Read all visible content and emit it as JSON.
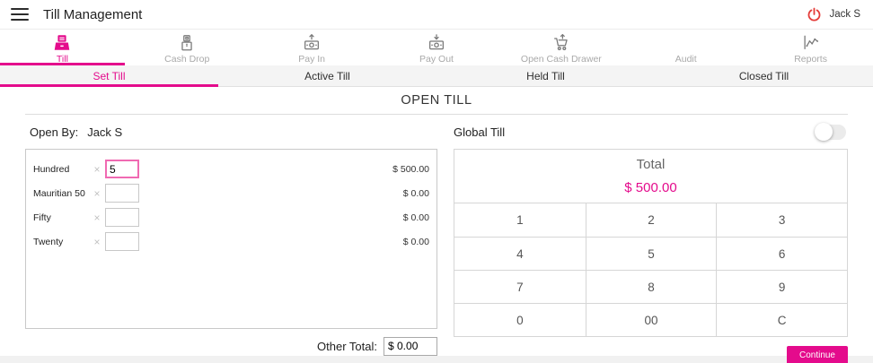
{
  "header": {
    "title": "Till Management",
    "user": "Jack S"
  },
  "nav": {
    "items": [
      {
        "label": "Till",
        "icon": "till-icon",
        "active": true
      },
      {
        "label": "Cash Drop",
        "icon": "cash-drop-icon",
        "active": false
      },
      {
        "label": "Pay In",
        "icon": "pay-in-icon",
        "active": false
      },
      {
        "label": "Pay Out",
        "icon": "pay-out-icon",
        "active": false
      },
      {
        "label": "Open Cash Drawer",
        "icon": "cart-up-icon",
        "active": false
      },
      {
        "label": "Audit",
        "icon": "none",
        "active": false
      },
      {
        "label": "Reports",
        "icon": "reports-chart-icon",
        "active": false
      }
    ]
  },
  "tabs": {
    "items": [
      {
        "label": "Set Till",
        "active": true
      },
      {
        "label": "Active Till",
        "active": false
      },
      {
        "label": "Held Till",
        "active": false
      },
      {
        "label": "Closed Till",
        "active": false
      }
    ]
  },
  "page": {
    "title": "OPEN TILL",
    "open_by_label": "Open By:",
    "open_by_value": "Jack S"
  },
  "denominations": {
    "multiply_symbol": "×",
    "rows": [
      {
        "label": "Hundred",
        "qty": "5",
        "amount": "$ 500.00"
      },
      {
        "label": "Mauritian 50",
        "qty": "",
        "amount": "$ 0.00"
      },
      {
        "label": "Fifty",
        "qty": "",
        "amount": "$ 0.00"
      },
      {
        "label": "Twenty",
        "qty": "",
        "amount": "$ 0.00"
      }
    ],
    "other_total_label": "Other Total:",
    "other_total_value": "$ 0.00"
  },
  "global_till": {
    "label": "Global Till",
    "toggle_state": "off",
    "total_label": "Total",
    "total_value": "$ 500.00",
    "keypad": [
      [
        "1",
        "2",
        "3"
      ],
      [
        "4",
        "5",
        "6"
      ],
      [
        "7",
        "8",
        "9"
      ],
      [
        "0",
        "00",
        "C"
      ]
    ]
  },
  "actions": {
    "continue_label": "Continue"
  },
  "colors": {
    "accent_pink": "#e40b8c",
    "power_red": "#e43d3a",
    "inactive_gray": "#a9a9a9"
  }
}
